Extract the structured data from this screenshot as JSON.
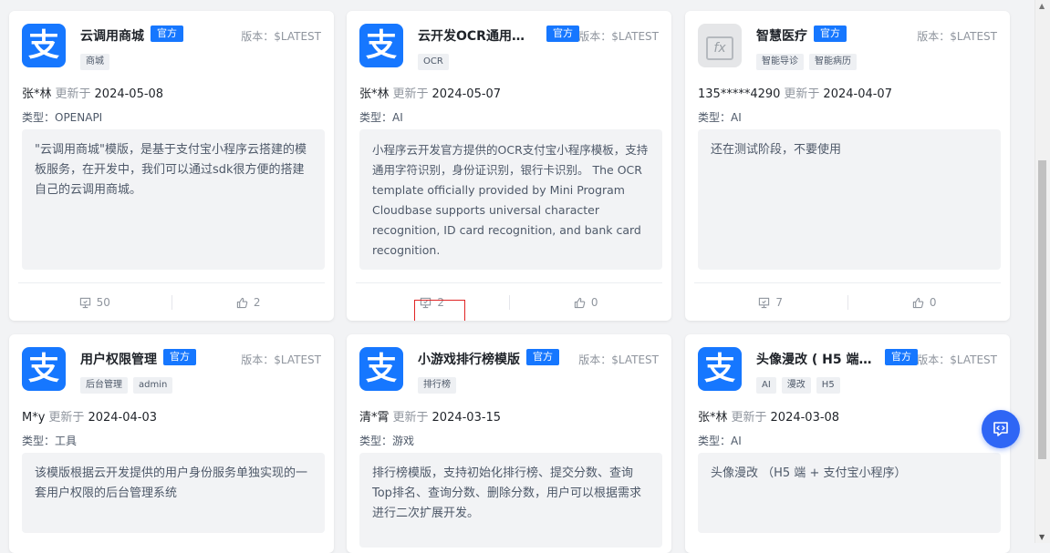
{
  "cards": [
    {
      "title": "云调用商城",
      "badge": "官方",
      "version": "版本：$LATEST",
      "tags": [
        "商城"
      ],
      "author": "张*林",
      "updated_label": "更新于",
      "date": "2024-05-08",
      "type": "类型：OPENAPI",
      "description": "\"云调用商城\"模版，是基于支付宝小程序云搭建的模板服务，在开发中，我们可以通过sdk很方便的搭建自己的云调用商城。",
      "views": "50",
      "likes": "2"
    },
    {
      "title": "云开发OCR通用识...",
      "badge": "官方",
      "version": "版本：$LATEST",
      "tags": [
        "OCR"
      ],
      "author": "张*林",
      "updated_label": "更新于",
      "date": "2024-05-07",
      "type": "类型：AI",
      "description": "小程序云开发官方提供的OCR支付宝小程序模板，支持通用字符识别，身份证识别，银行卡识别。 The OCR template officially provided by Mini Program Cloudbase supports universal character recognition, ID card recognition, and bank card recognition.",
      "views": "2",
      "likes": "0"
    },
    {
      "title": "智慧医疗",
      "badge": "官方",
      "version": "版本：$LATEST",
      "tags": [
        "智能导诊",
        "智能病历"
      ],
      "author": "135*****4290",
      "updated_label": "更新于",
      "date": "2024-04-07",
      "type": "类型：AI",
      "description": "还在测试阶段，不要使用",
      "views": "7",
      "likes": "0"
    },
    {
      "title": "用户权限管理",
      "badge": "官方",
      "version": "版本：$LATEST",
      "tags": [
        "后台管理",
        "admin"
      ],
      "author": "M*y",
      "updated_label": "更新于",
      "date": "2024-04-03",
      "type": "类型：工具",
      "description": "该模版根据云开发提供的用户身份服务单独实现的一套用户权限的后台管理系统"
    },
    {
      "title": "小游戏排行榜模版",
      "badge": "官方",
      "version": "版本：$LATEST",
      "tags": [
        "排行榜"
      ],
      "author": "清*霄",
      "updated_label": "更新于",
      "date": "2024-03-15",
      "type": "类型：游戏",
      "description": "排行榜模版，支持初始化排行榜、提交分数、查询Top排名、查询分数、删除分数，用户可以根据需求进行二次扩展开发。"
    },
    {
      "title": "头像漫改 ( H5 端 ...",
      "badge": "官方",
      "version": "版本：$LATEST",
      "tags": [
        "AI",
        "漫改",
        "H5"
      ],
      "author": "张*林",
      "updated_label": "更新于",
      "date": "2024-03-08",
      "type": "类型：AI",
      "description": "头像漫改 （H5 端 + 支付宝小程序）"
    }
  ],
  "logo_glyph": "支",
  "icons": {
    "logo": "alipay-logo-icon",
    "views": "views-icon",
    "likes": "thumbs-up-icon",
    "float": "code-icon"
  },
  "colors": {
    "accent": "#1677ff",
    "highlight": "#e02424",
    "float_button": "#2f66f5"
  }
}
